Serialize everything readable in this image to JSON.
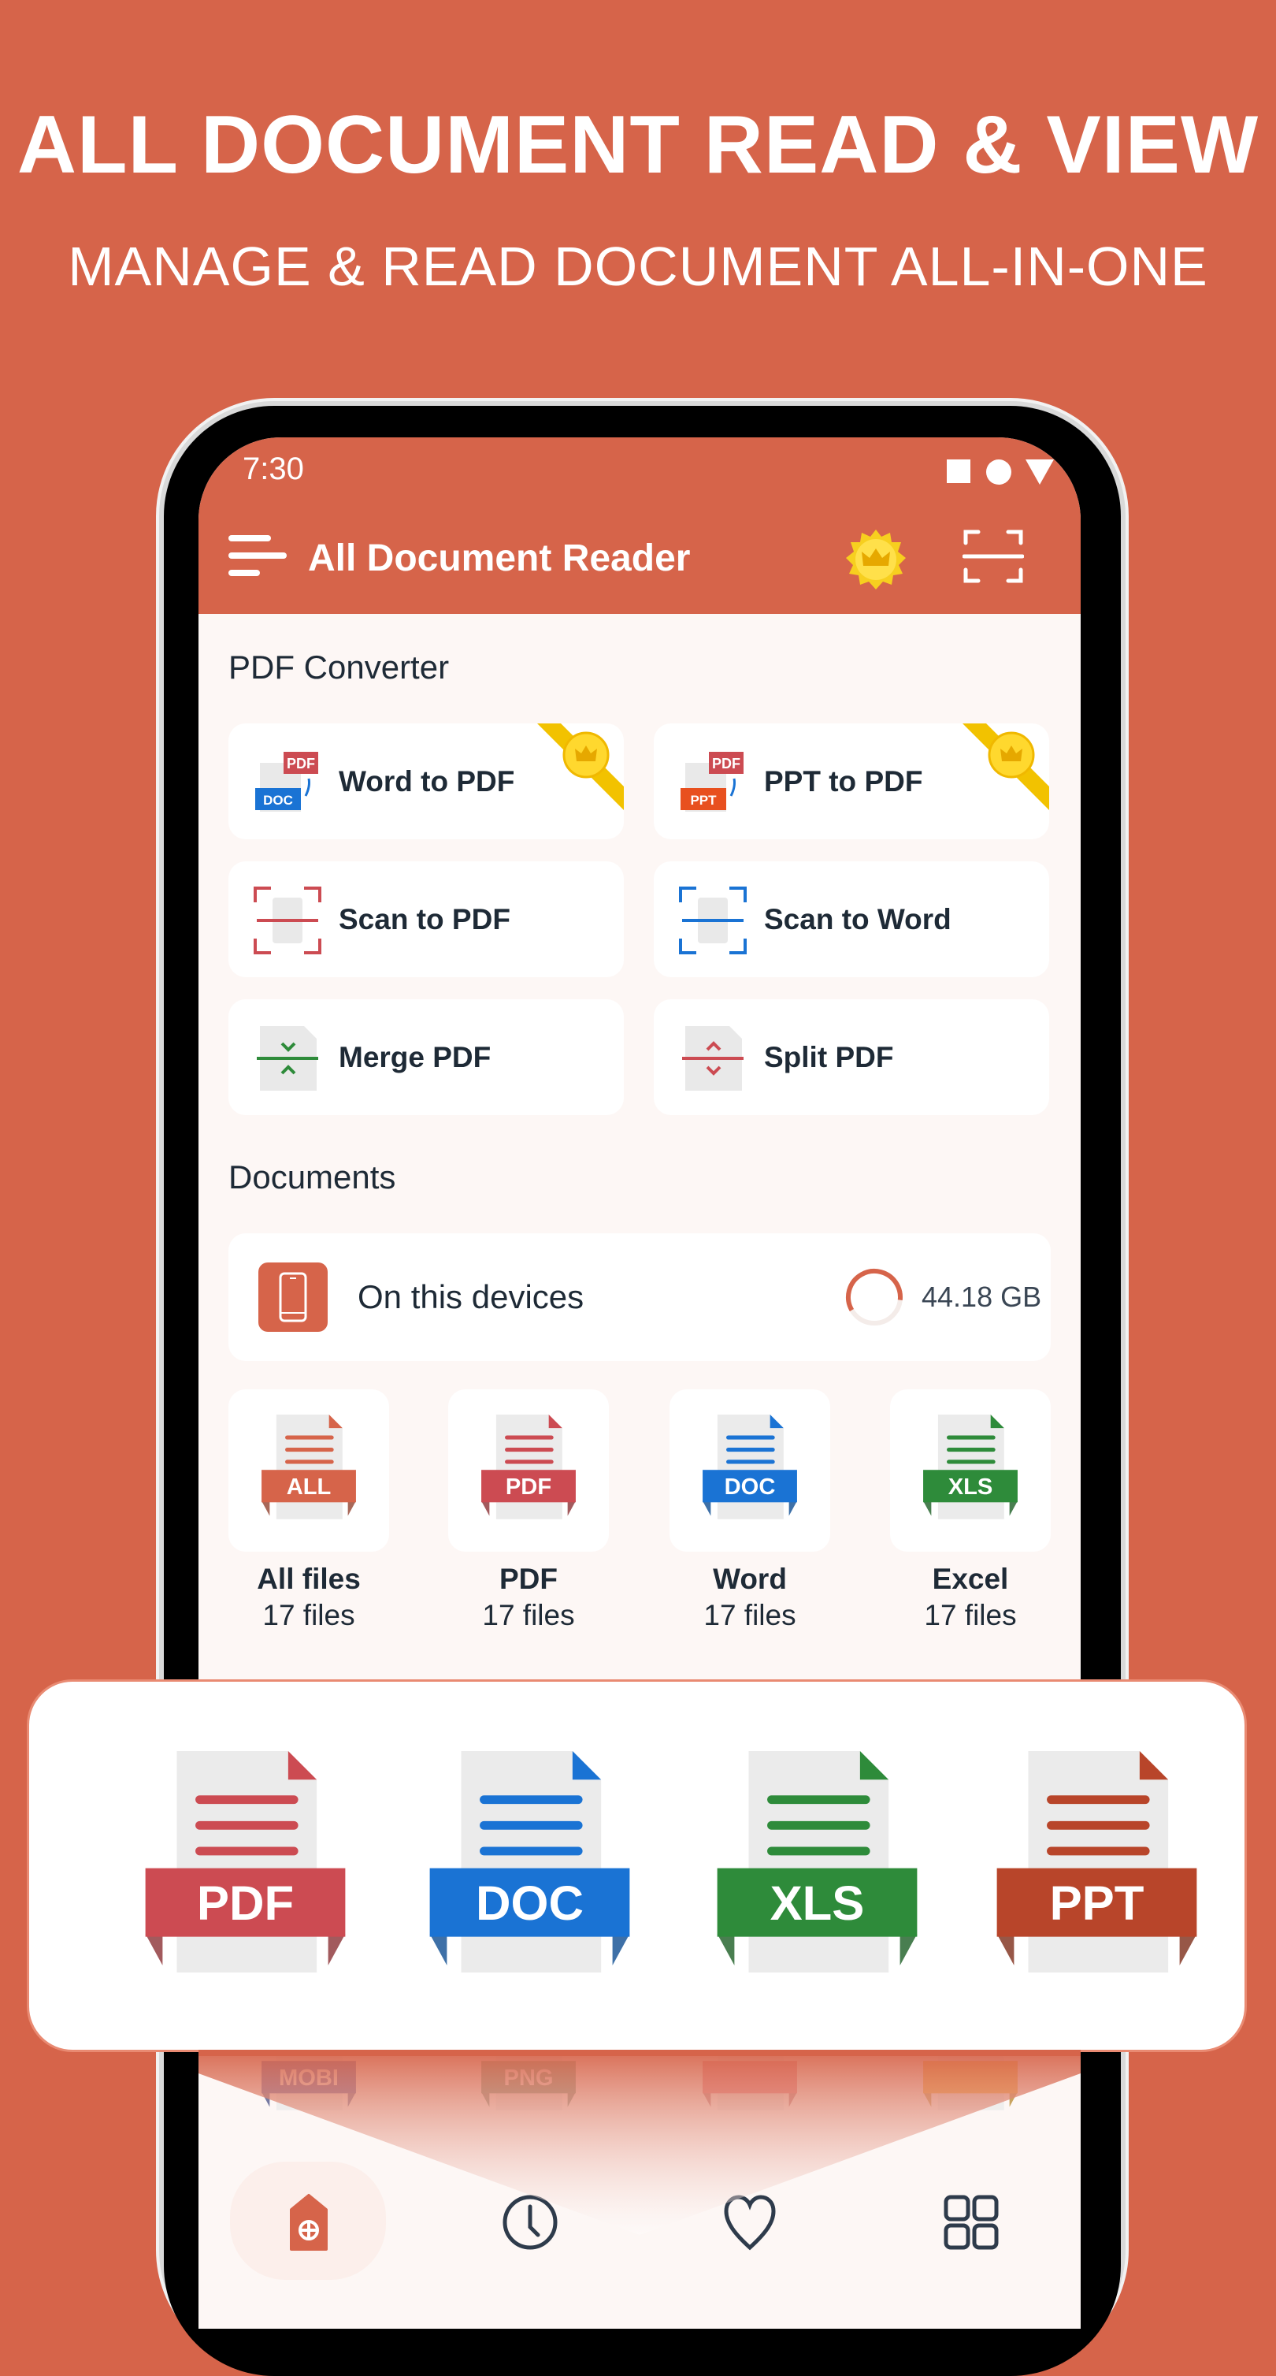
{
  "headline": "ALL DOCUMENT READ & VIEW",
  "subheadline": "MANAGE & READ DOCUMENT ALL-IN-ONE",
  "colors": {
    "brand": "#d6644a",
    "pdf": "#cc4b52",
    "doc": "#1a73d4",
    "xls": "#2e8b3a",
    "ppt": "#b8452a",
    "premium": "#f2c200",
    "text": "#1e2a36"
  },
  "status_bar": {
    "time": "7:30",
    "icons": [
      "square-icon",
      "circle-icon",
      "triangle-icon"
    ]
  },
  "app_bar": {
    "title": "All Document Reader",
    "icons": [
      "menu-icon",
      "premium-crown-icon",
      "scan-icon"
    ]
  },
  "pdf_converter": {
    "title": "PDF Converter",
    "tools": [
      {
        "label": "Word to PDF",
        "premium": true
      },
      {
        "label": "PPT to PDF",
        "premium": true
      },
      {
        "label": "Scan to PDF",
        "premium": false
      },
      {
        "label": "Scan to Word",
        "premium": false
      },
      {
        "label": "Merge PDF",
        "premium": false
      },
      {
        "label": "Split PDF",
        "premium": false
      }
    ]
  },
  "documents": {
    "title": "Documents",
    "device": {
      "label": "On this devices",
      "storage": "44.18 GB",
      "storage_ring_fraction": 0.6
    },
    "types": [
      {
        "badge": "ALL",
        "name": "All files",
        "count": "17 files",
        "color": "#d6644a"
      },
      {
        "badge": "PDF",
        "name": "PDF",
        "count": "17 files",
        "color": "#cc4b52"
      },
      {
        "badge": "DOC",
        "name": "Word",
        "count": "17 files",
        "color": "#1a73d4"
      },
      {
        "badge": "XLS",
        "name": "Excel",
        "count": "17 files",
        "color": "#2e8b3a"
      }
    ],
    "more_types": [
      {
        "badge": "MOBI",
        "color": "#2b3a9c"
      },
      {
        "badge": "PNG",
        "color": "#4f8a6e"
      },
      {
        "badge": "",
        "color": "#e35d6a"
      },
      {
        "badge": "",
        "color": "#f0a000"
      }
    ]
  },
  "feature_icons": [
    {
      "badge": "PDF",
      "color": "#cc4b52"
    },
    {
      "badge": "DOC",
      "color": "#1a73d4"
    },
    {
      "badge": "XLS",
      "color": "#2e8b3a"
    },
    {
      "badge": "PPT",
      "color": "#b8452a"
    }
  ],
  "bottom_nav": [
    {
      "icon": "home-icon",
      "active": true
    },
    {
      "icon": "recent-clock-icon"
    },
    {
      "icon": "favorite-heart-icon"
    },
    {
      "icon": "apps-grid-icon"
    }
  ]
}
